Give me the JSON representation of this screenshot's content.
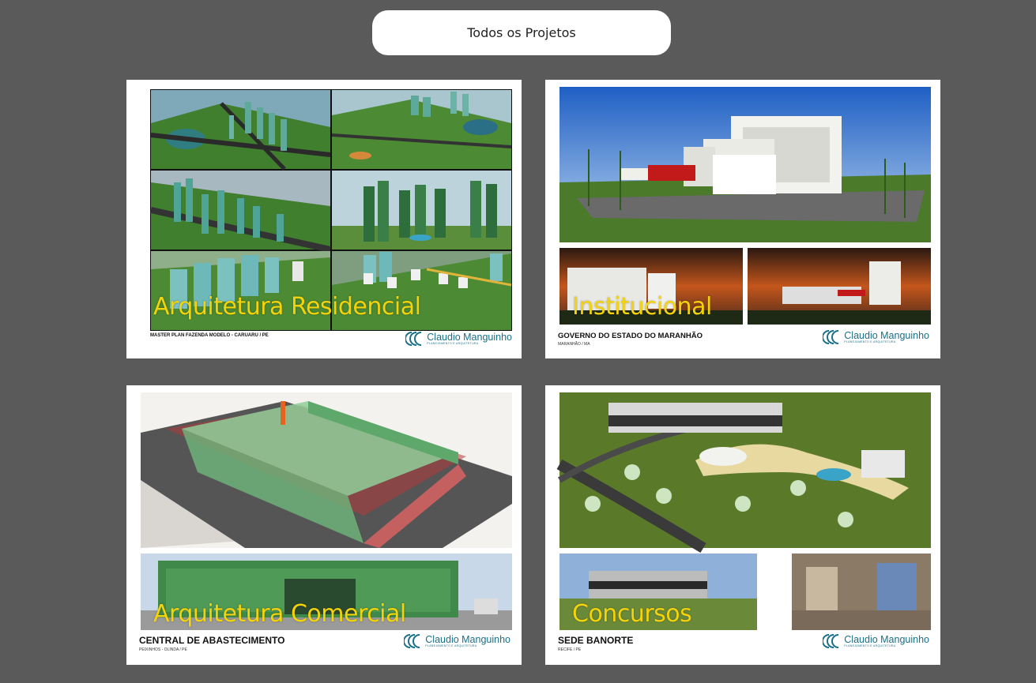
{
  "filter": {
    "label": "Todos os Projetos"
  },
  "logo": {
    "name": "Claudio Manguinho",
    "tagline": "PLANEJAMENTO E ARQUITETURA"
  },
  "projects": [
    {
      "title": "Arquitetura Residencial",
      "caption": "MASTER PLAN FAZENDA MODELO - CARUARU / PE",
      "subcaption": ""
    },
    {
      "title": "Institucional",
      "caption": "GOVERNO DO ESTADO DO MARANHÃO",
      "subcaption": "MARANHÃO / MA"
    },
    {
      "title": "Arquitetura Comercial",
      "caption": "CENTRAL DE ABASTECIMENTO",
      "subcaption": "PEIXINHOS - OLINDA / PE"
    },
    {
      "title": "Concursos",
      "caption": "SEDE BANORTE",
      "subcaption": "RECIFE / PE"
    }
  ],
  "colors": {
    "background": "#5a5a5a",
    "title": "#f5d30a",
    "logo": "#1a6f86"
  }
}
